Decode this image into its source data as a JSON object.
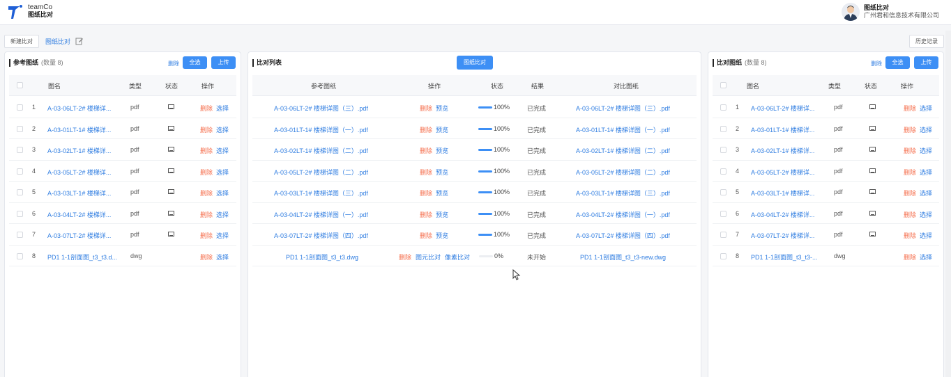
{
  "header": {
    "brand_name": "teamCo",
    "app_title": "图纸比对",
    "user_title": "图纸比对",
    "company": "广州君和信息技术有限公司"
  },
  "toolbar": {
    "new_compare": "新建比对",
    "breadcrumb": "图纸比对",
    "history": "历史记录"
  },
  "ref_panel": {
    "title": "参考图纸",
    "count": "(数量 8)",
    "delete": "删除",
    "select_all": "全选",
    "upload": "上传",
    "columns": [
      "图名",
      "类型",
      "状态",
      "操作"
    ],
    "rows": [
      {
        "no": "1",
        "name": "A-03-06LT-2# 楼梯详...",
        "type": "pdf"
      },
      {
        "no": "2",
        "name": "A-03-01LT-1# 楼梯详...",
        "type": "pdf"
      },
      {
        "no": "3",
        "name": "A-03-02LT-1# 楼梯详...",
        "type": "pdf"
      },
      {
        "no": "4",
        "name": "A-03-05LT-2# 楼梯详...",
        "type": "pdf"
      },
      {
        "no": "5",
        "name": "A-03-03LT-1# 楼梯详...",
        "type": "pdf"
      },
      {
        "no": "6",
        "name": "A-03-04LT-2# 楼梯详...",
        "type": "pdf"
      },
      {
        "no": "7",
        "name": "A-03-07LT-2# 楼梯详...",
        "type": "pdf"
      },
      {
        "no": "8",
        "name": "PD1 1-1剖面图_t3_t3.d...",
        "type": "dwg"
      }
    ],
    "op_delete": "删除",
    "op_select": "选择"
  },
  "compare_panel": {
    "title": "比对列表",
    "compare_button": "图纸比对",
    "columns": [
      "参考图纸",
      "操作",
      "状态",
      "结果",
      "对比图纸"
    ],
    "rows": [
      {
        "ref": "A-03-06LT-2# 楼梯详图（三）.pdf",
        "ops": [
          "删除",
          "预览"
        ],
        "progress": 100,
        "progress_text": "100%",
        "result": "已完成",
        "target": "A-03-06LT-2# 楼梯详图（三）.pdf"
      },
      {
        "ref": "A-03-01LT-1# 楼梯详图（一）.pdf",
        "ops": [
          "删除",
          "预览"
        ],
        "progress": 100,
        "progress_text": "100%",
        "result": "已完成",
        "target": "A-03-01LT-1# 楼梯详图（一）.pdf"
      },
      {
        "ref": "A-03-02LT-1# 楼梯详图（二）.pdf",
        "ops": [
          "删除",
          "预览"
        ],
        "progress": 100,
        "progress_text": "100%",
        "result": "已完成",
        "target": "A-03-02LT-1# 楼梯详图（二）.pdf"
      },
      {
        "ref": "A-03-05LT-2# 楼梯详图（二）.pdf",
        "ops": [
          "删除",
          "预览"
        ],
        "progress": 100,
        "progress_text": "100%",
        "result": "已完成",
        "target": "A-03-05LT-2# 楼梯详图（二）.pdf"
      },
      {
        "ref": "A-03-03LT-1# 楼梯详图（三）.pdf",
        "ops": [
          "删除",
          "预览"
        ],
        "progress": 100,
        "progress_text": "100%",
        "result": "已完成",
        "target": "A-03-03LT-1# 楼梯详图（三）.pdf"
      },
      {
        "ref": "A-03-04LT-2# 楼梯详图（一）.pdf",
        "ops": [
          "删除",
          "预览"
        ],
        "progress": 100,
        "progress_text": "100%",
        "result": "已完成",
        "target": "A-03-04LT-2# 楼梯详图（一）.pdf"
      },
      {
        "ref": "A-03-07LT-2# 楼梯详图（四）.pdf",
        "ops": [
          "删除",
          "预览"
        ],
        "progress": 100,
        "progress_text": "100%",
        "result": "已完成",
        "target": "A-03-07LT-2# 楼梯详图（四）.pdf"
      },
      {
        "ref": "PD1 1-1剖面图_t3_t3.dwg",
        "ops": [
          "删除",
          "图元比对",
          "像素比对"
        ],
        "progress": 0,
        "progress_text": "0%",
        "result": "未开始",
        "target": "PD1 1-1剖面图_t3_t3-new.dwg"
      }
    ]
  },
  "target_panel": {
    "title": "比对图纸",
    "count": "(数量 8)",
    "delete": "删除",
    "select_all": "全选",
    "upload": "上传",
    "columns": [
      "图名",
      "类型",
      "状态",
      "操作"
    ],
    "rows": [
      {
        "no": "1",
        "name": "A-03-06LT-2# 楼梯详...",
        "type": "pdf"
      },
      {
        "no": "2",
        "name": "A-03-01LT-1# 楼梯详...",
        "type": "pdf"
      },
      {
        "no": "3",
        "name": "A-03-02LT-1# 楼梯详...",
        "type": "pdf"
      },
      {
        "no": "4",
        "name": "A-03-05LT-2# 楼梯详...",
        "type": "pdf"
      },
      {
        "no": "5",
        "name": "A-03-03LT-1# 楼梯详...",
        "type": "pdf"
      },
      {
        "no": "6",
        "name": "A-03-04LT-2# 楼梯详...",
        "type": "pdf"
      },
      {
        "no": "7",
        "name": "A-03-07LT-2# 楼梯详...",
        "type": "pdf"
      },
      {
        "no": "8",
        "name": "PD1 1-1剖面图_t3_t3-...",
        "type": "dwg"
      }
    ],
    "op_delete": "删除",
    "op_select": "选择"
  },
  "colors": {
    "accent": "#3d8ff5",
    "link": "#2f7de1",
    "danger": "#f56c4a"
  }
}
